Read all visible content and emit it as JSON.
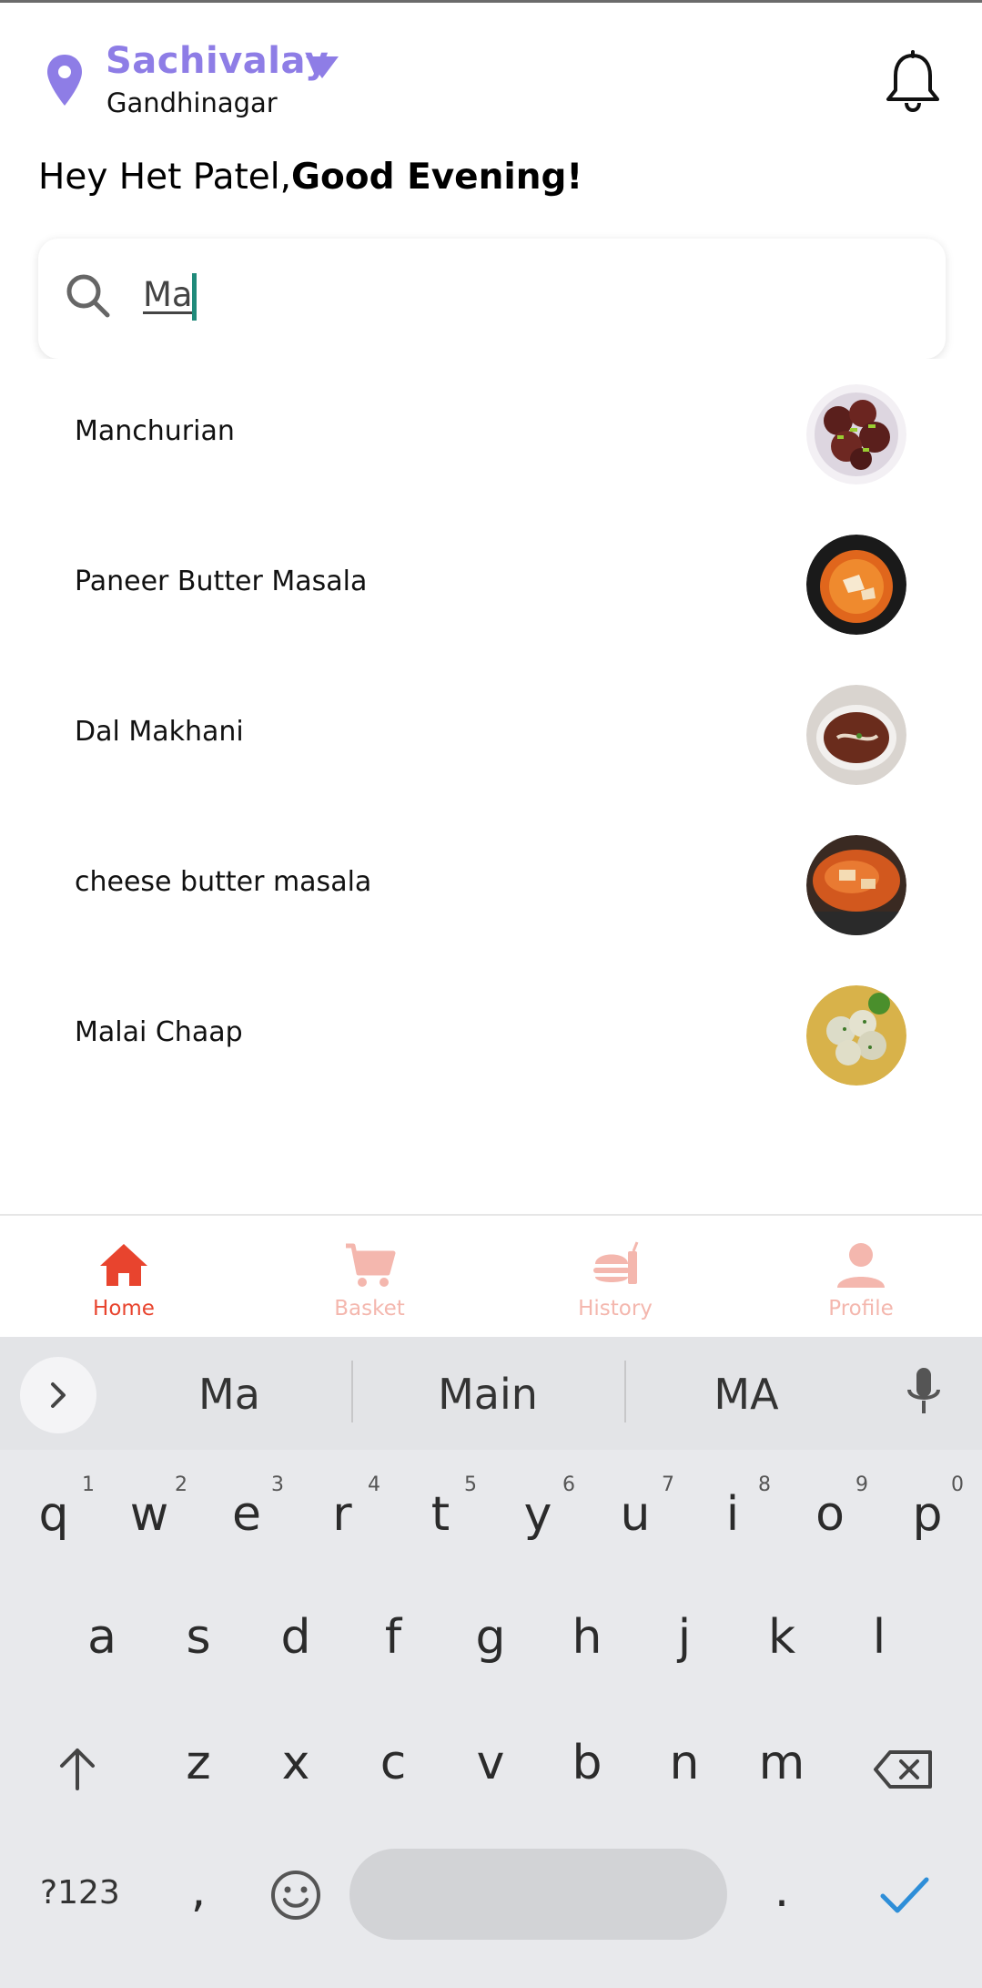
{
  "header": {
    "location_name": "Sachivalay",
    "location_sub": "Gandhinagar",
    "greeting_prefix": "Hey Het Patel,",
    "greeting_bold": "Good Evening!"
  },
  "search": {
    "value": "Ma"
  },
  "suggestions": [
    {
      "label": "Manchurian",
      "icon": "manchurian-thumb"
    },
    {
      "label": "Paneer Butter Masala",
      "icon": "paneer-thumb"
    },
    {
      "label": "Dal Makhani",
      "icon": "dal-thumb"
    },
    {
      "label": "cheese butter masala",
      "icon": "cheese-masala-thumb"
    },
    {
      "label": "Malai Chaap",
      "icon": "chaap-thumb"
    }
  ],
  "bottom_nav": [
    {
      "label": "Home",
      "icon": "home-icon",
      "active": true
    },
    {
      "label": "Basket",
      "icon": "cart-icon",
      "active": false
    },
    {
      "label": "History",
      "icon": "burger-icon",
      "active": false
    },
    {
      "label": "Profile",
      "icon": "person-icon",
      "active": false
    }
  ],
  "keyboard": {
    "suggestions": [
      "Ma",
      "Main",
      "MA"
    ],
    "row1": [
      "q",
      "w",
      "e",
      "r",
      "t",
      "y",
      "u",
      "i",
      "o",
      "p"
    ],
    "row1_hints": [
      "1",
      "2",
      "3",
      "4",
      "5",
      "6",
      "7",
      "8",
      "9",
      "0"
    ],
    "row2": [
      "a",
      "s",
      "d",
      "f",
      "g",
      "h",
      "j",
      "k",
      "l"
    ],
    "row3": [
      "z",
      "x",
      "c",
      "v",
      "b",
      "n",
      "m"
    ],
    "symbols_label": "?123",
    "comma": ",",
    "period": "."
  },
  "colors": {
    "accent_purple": "#8e7de6",
    "nav_active": "#e8442e",
    "nav_inactive": "#f4b7ae",
    "caret": "#1f8a7a",
    "keyboard_bg": "#e8e9ec"
  }
}
